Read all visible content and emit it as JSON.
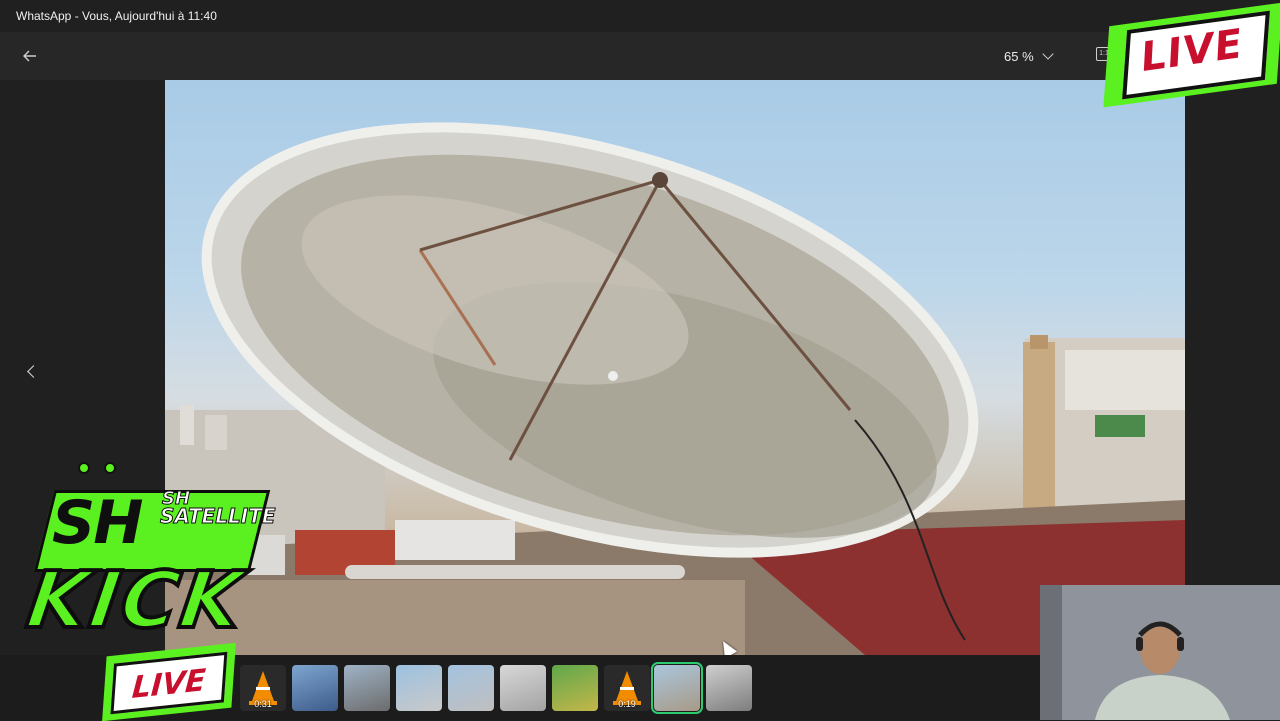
{
  "window": {
    "title": "WhatsApp - Vous, Aujourd'hui à 11:40"
  },
  "toolbar": {
    "back_icon": "arrow-left-icon",
    "zoom_level": "65 %",
    "zoom_chevron_icon": "chevron-down-icon",
    "actual_size_label": "1:1"
  },
  "viewer": {
    "prev_icon": "chevron-left-icon",
    "image_subject": "satellite dish on rooftop"
  },
  "filmstrip": {
    "thumbnails": [
      {
        "kind": "video",
        "duration": "0:31",
        "icon": "vlc-cone-icon"
      },
      {
        "kind": "image",
        "duration": ""
      },
      {
        "kind": "image",
        "duration": ""
      },
      {
        "kind": "image",
        "duration": ""
      },
      {
        "kind": "image",
        "duration": ""
      },
      {
        "kind": "image",
        "duration": ""
      },
      {
        "kind": "image",
        "duration": ""
      },
      {
        "kind": "video",
        "duration": "0:19",
        "icon": "vlc-cone-icon"
      },
      {
        "kind": "image",
        "duration": "",
        "selected": true
      },
      {
        "kind": "image",
        "duration": ""
      }
    ]
  },
  "overlay": {
    "live_top": "LIVE",
    "sh_big": "SH",
    "sh_small": "SH",
    "satellite": "SATELLITE",
    "kick": "KICK",
    "live_bottom": "LIVE",
    "accent_green": "#5bf01f",
    "live_red": "#c8102e"
  }
}
